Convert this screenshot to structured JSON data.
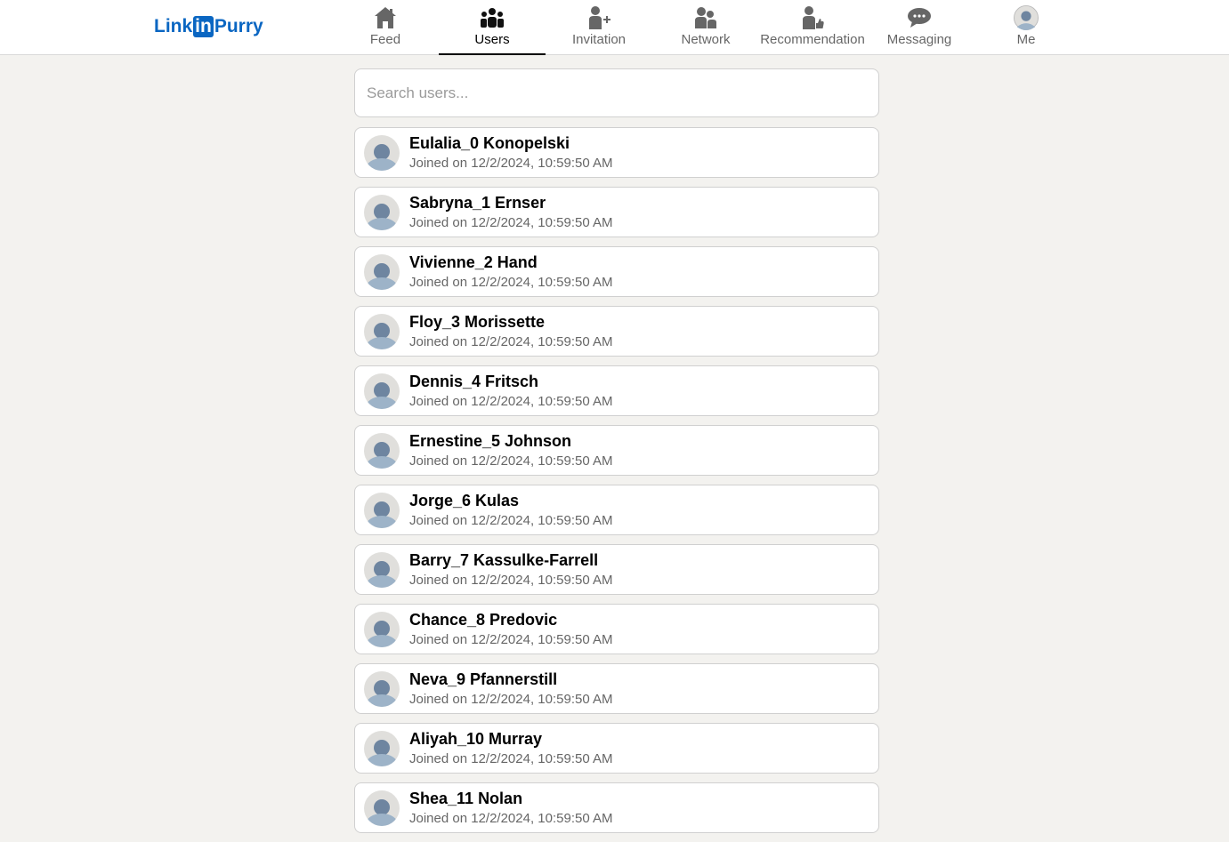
{
  "brand": {
    "logo_prefix": "Link",
    "logo_badge": "in",
    "logo_suffix": "Purry",
    "color": "#0a66c2"
  },
  "nav": {
    "items": [
      {
        "label": "Feed",
        "icon": "home-icon",
        "active": false
      },
      {
        "label": "Users",
        "icon": "users-icon",
        "active": true
      },
      {
        "label": "Invitation",
        "icon": "user-plus-icon",
        "active": false
      },
      {
        "label": "Network",
        "icon": "network-icon",
        "active": false
      },
      {
        "label": "Recommendation",
        "icon": "recommendation-icon",
        "active": false
      },
      {
        "label": "Messaging",
        "icon": "message-icon",
        "active": false
      },
      {
        "label": "Me",
        "icon": "avatar-icon",
        "active": false
      }
    ]
  },
  "search": {
    "placeholder": "Search users...",
    "value": ""
  },
  "users": [
    {
      "name": "Eulalia_0 Konopelski",
      "joined": "Joined on 12/2/2024, 10:59:50 AM"
    },
    {
      "name": "Sabryna_1 Ernser",
      "joined": "Joined on 12/2/2024, 10:59:50 AM"
    },
    {
      "name": "Vivienne_2 Hand",
      "joined": "Joined on 12/2/2024, 10:59:50 AM"
    },
    {
      "name": "Floy_3 Morissette",
      "joined": "Joined on 12/2/2024, 10:59:50 AM"
    },
    {
      "name": "Dennis_4 Fritsch",
      "joined": "Joined on 12/2/2024, 10:59:50 AM"
    },
    {
      "name": "Ernestine_5 Johnson",
      "joined": "Joined on 12/2/2024, 10:59:50 AM"
    },
    {
      "name": "Jorge_6 Kulas",
      "joined": "Joined on 12/2/2024, 10:59:50 AM"
    },
    {
      "name": "Barry_7 Kassulke-Farrell",
      "joined": "Joined on 12/2/2024, 10:59:50 AM"
    },
    {
      "name": "Chance_8 Predovic",
      "joined": "Joined on 12/2/2024, 10:59:50 AM"
    },
    {
      "name": "Neva_9 Pfannerstill",
      "joined": "Joined on 12/2/2024, 10:59:50 AM"
    },
    {
      "name": "Aliyah_10 Murray",
      "joined": "Joined on 12/2/2024, 10:59:50 AM"
    },
    {
      "name": "Shea_11 Nolan",
      "joined": "Joined on 12/2/2024, 10:59:50 AM"
    }
  ]
}
